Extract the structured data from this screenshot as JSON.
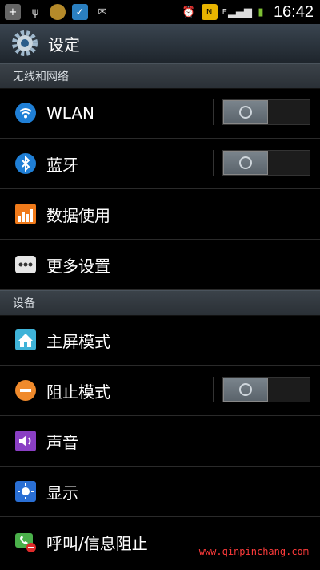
{
  "status": {
    "time": "16:42",
    "network": "E"
  },
  "header": {
    "title": "设定"
  },
  "sections": [
    {
      "title": "无线和网络"
    },
    {
      "title": "设备"
    }
  ],
  "rows": [
    {
      "label": "WLAN",
      "icon": "wifi-icon",
      "toggle": "off"
    },
    {
      "label": "蓝牙",
      "icon": "bluetooth-icon",
      "toggle": "off"
    },
    {
      "label": "数据使用",
      "icon": "data-usage-icon"
    },
    {
      "label": "更多设置",
      "icon": "more-icon"
    },
    {
      "label": "主屏模式",
      "icon": "home-icon"
    },
    {
      "label": "阻止模式",
      "icon": "block-icon",
      "toggle": "off"
    },
    {
      "label": "声音",
      "icon": "sound-icon"
    },
    {
      "label": "显示",
      "icon": "display-icon"
    },
    {
      "label": "呼叫/信息阻止",
      "icon": "call-block-icon"
    }
  ],
  "watermark": "www.qinpinchang.com"
}
